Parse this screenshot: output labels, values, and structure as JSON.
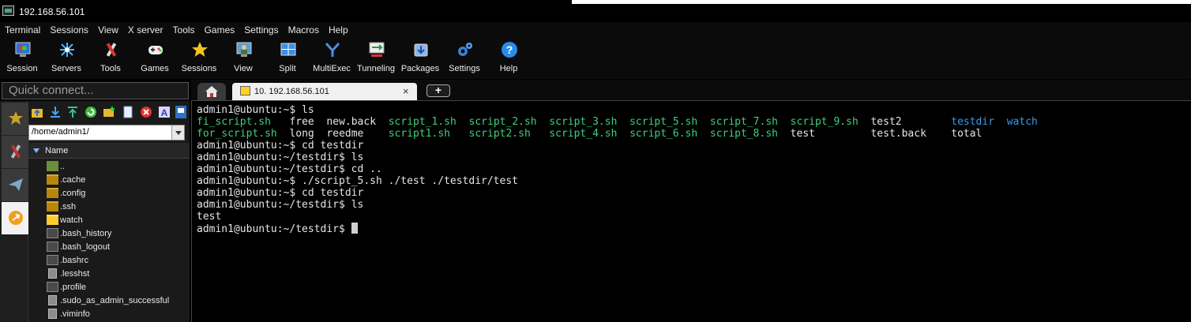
{
  "window": {
    "title": "192.168.56.101"
  },
  "menu": [
    "Terminal",
    "Sessions",
    "View",
    "X server",
    "Tools",
    "Games",
    "Settings",
    "Macros",
    "Help"
  ],
  "toolbar": [
    "Session",
    "Servers",
    "Tools",
    "Games",
    "Sessions",
    "View",
    "Split",
    "MultiExec",
    "Tunneling",
    "Packages",
    "Settings",
    "Help"
  ],
  "quick_connect": {
    "placeholder": "Quick connect..."
  },
  "tabs": {
    "session_label": "10. 192.168.56.101",
    "close": "×",
    "add": "+"
  },
  "browser": {
    "path": "/home/admin1/",
    "column": "Name",
    "files": [
      {
        "name": "..",
        "kind": "up"
      },
      {
        "name": ".cache",
        "kind": "folder"
      },
      {
        "name": ".config",
        "kind": "folder"
      },
      {
        "name": ".ssh",
        "kind": "folder"
      },
      {
        "name": "watch",
        "kind": "folder-yellow"
      },
      {
        "name": ".bash_history",
        "kind": "file"
      },
      {
        "name": ".bash_logout",
        "kind": "file"
      },
      {
        "name": ".bashrc",
        "kind": "file"
      },
      {
        "name": ".lesshst",
        "kind": "doc"
      },
      {
        "name": ".profile",
        "kind": "file"
      },
      {
        "name": ".sudo_as_admin_successful",
        "kind": "doc"
      },
      {
        "name": ".viminfo",
        "kind": "doc"
      }
    ]
  },
  "terminal": {
    "colors": {
      "exec": "#3fd07a",
      "dir": "#3a9be8",
      "plain": "#e6e6e6"
    },
    "lines": [
      {
        "type": "text",
        "text": "admin1@ubuntu:~$ ls"
      },
      {
        "type": "ls",
        "entries": [
          {
            "text": "fi_script.sh",
            "style": "exec"
          },
          {
            "text": "free",
            "style": "plain"
          },
          {
            "text": "new.back",
            "style": "plain"
          },
          {
            "text": "script_1.sh",
            "style": "exec"
          },
          {
            "text": "script_2.sh",
            "style": "exec"
          },
          {
            "text": "script_3.sh",
            "style": "exec"
          },
          {
            "text": "script_5.sh",
            "style": "exec"
          },
          {
            "text": "script_7.sh",
            "style": "exec"
          },
          {
            "text": "script_9.sh",
            "style": "exec"
          },
          {
            "text": "test2",
            "style": "plain"
          },
          {
            "text": "testdir",
            "style": "dir"
          },
          {
            "text": "watch",
            "style": "dir"
          }
        ]
      },
      {
        "type": "ls",
        "entries": [
          {
            "text": "for_script.sh",
            "style": "exec"
          },
          {
            "text": "long",
            "style": "plain"
          },
          {
            "text": "reedme",
            "style": "plain"
          },
          {
            "text": "script1.sh",
            "style": "exec"
          },
          {
            "text": "script2.sh",
            "style": "exec"
          },
          {
            "text": "script_4.sh",
            "style": "exec"
          },
          {
            "text": "script_6.sh",
            "style": "exec"
          },
          {
            "text": "script_8.sh",
            "style": "exec"
          },
          {
            "text": "test",
            "style": "plain"
          },
          {
            "text": "test.back",
            "style": "plain"
          },
          {
            "text": "total",
            "style": "plain"
          }
        ]
      },
      {
        "type": "text",
        "text": "admin1@ubuntu:~$ cd testdir"
      },
      {
        "type": "text",
        "text": "admin1@ubuntu:~/testdir$ ls"
      },
      {
        "type": "text",
        "text": "admin1@ubuntu:~/testdir$ cd .."
      },
      {
        "type": "text",
        "text": "admin1@ubuntu:~$ ./script_5.sh ./test ./testdir/test"
      },
      {
        "type": "text",
        "text": "admin1@ubuntu:~$ cd testdir"
      },
      {
        "type": "text",
        "text": "admin1@ubuntu:~/testdir$ ls"
      },
      {
        "type": "text",
        "text": "test"
      },
      {
        "type": "prompt",
        "text": "admin1@ubuntu:~/testdir$ "
      }
    ]
  }
}
